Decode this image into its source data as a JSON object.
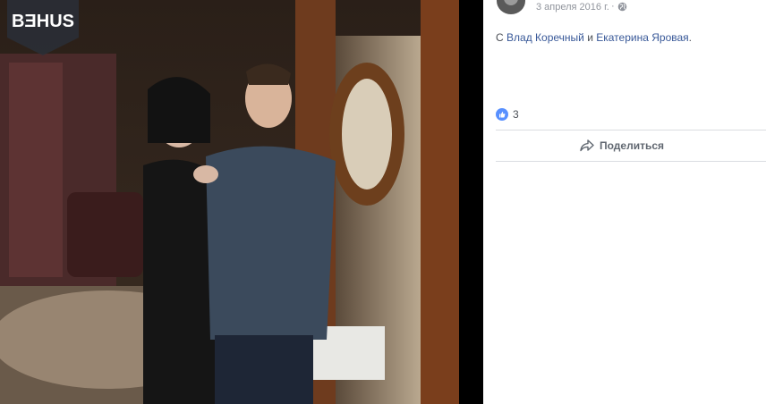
{
  "watermark": {
    "logo_text": "BƎHUS"
  },
  "post": {
    "date": "3 апреля 2016 г.",
    "separator": "·",
    "privacy_icon": "globe-icon",
    "tag_prefix": "С",
    "tagged_1": "Влад Коречный",
    "tag_joiner": "и",
    "tagged_2": "Екатерина Яровая",
    "tag_suffix": "."
  },
  "reactions": {
    "icon": "like-icon",
    "count": "3"
  },
  "actions": {
    "share_label": "Поделиться",
    "share_icon": "share-icon"
  },
  "colors": {
    "link": "#385898",
    "like": "#5890ff",
    "meta": "#90949c"
  }
}
